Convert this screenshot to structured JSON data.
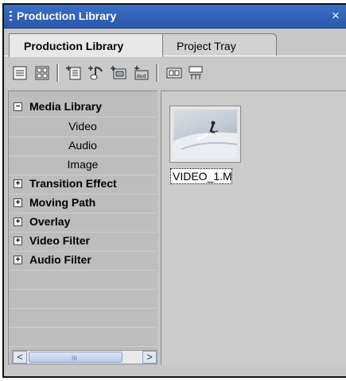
{
  "window": {
    "title": "Production Library",
    "close_glyph": "×"
  },
  "tabs": [
    {
      "label": "Production Library",
      "active": true
    },
    {
      "label": "Project Tray",
      "active": false
    }
  ],
  "toolbar": {
    "icons": [
      "list-view-icon",
      "thumbnail-view-icon",
      "import-clip-icon",
      "import-audio-icon",
      "add-folder-icon",
      "import-dvd-icon",
      "capture-icon",
      "timecode-icon"
    ]
  },
  "tree": {
    "items": [
      {
        "label": "Media Library",
        "expander": "−",
        "children": [
          "Video",
          "Audio",
          "Image"
        ]
      },
      {
        "label": "Transition Effect",
        "expander": "+"
      },
      {
        "label": "Moving Path",
        "expander": "+"
      },
      {
        "label": "Overlay",
        "expander": "+"
      },
      {
        "label": "Video Filter",
        "expander": "+"
      },
      {
        "label": "Audio Filter",
        "expander": "+"
      }
    ]
  },
  "scrollbar": {
    "left_arrow": "<",
    "right_arrow": ">",
    "grip": "III"
  },
  "media": {
    "items": [
      {
        "caption": "VIDEO_1.M"
      }
    ]
  }
}
